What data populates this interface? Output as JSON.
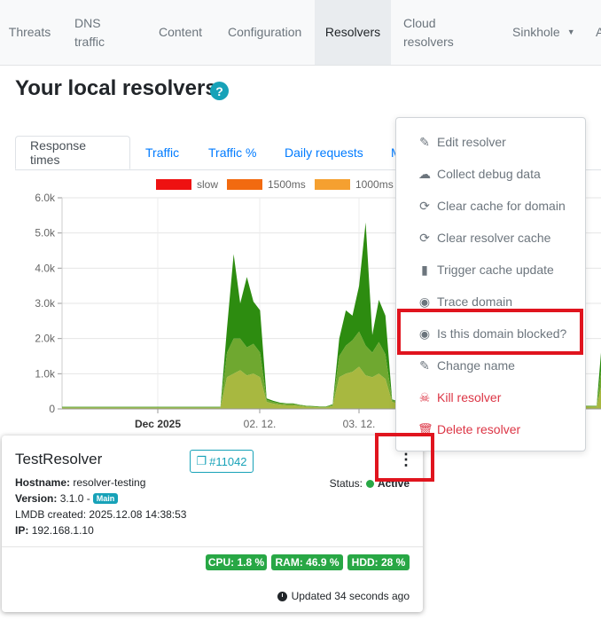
{
  "nav": {
    "items": [
      {
        "label": "Threats",
        "active": false
      },
      {
        "label": "DNS traffic",
        "active": false
      },
      {
        "label": "Content",
        "active": false
      },
      {
        "label": "Configuration",
        "active": false
      },
      {
        "label": "Resolvers",
        "active": true
      },
      {
        "label": "Cloud resolvers",
        "active": false
      },
      {
        "label": "Sinkhole",
        "active": false
      },
      {
        "label": "A",
        "active": false
      }
    ]
  },
  "page": {
    "title": "Your local resolvers",
    "help_icon": "question-circle-icon"
  },
  "tabs": [
    {
      "label": "Response times",
      "active": true
    },
    {
      "label": "Traffic",
      "active": false
    },
    {
      "label": "Traffic %",
      "active": false
    },
    {
      "label": "Daily requests",
      "active": false
    },
    {
      "label": "M",
      "active": false
    }
  ],
  "chart_data": {
    "type": "area",
    "stacked": true,
    "ylim": [
      0,
      6000
    ],
    "yticks": [
      "0",
      "1.0k",
      "2.0k",
      "3.0k",
      "4.0k",
      "5.0k",
      "6.0k"
    ],
    "xticks": [
      "Dec 2025",
      "02. 12.",
      "03. 12."
    ],
    "legend": [
      {
        "name": "slow",
        "color": "#ee1111"
      },
      {
        "name": "1500ms",
        "color": "#f26a10"
      },
      {
        "name": "1000ms",
        "color": "#f5a030"
      }
    ],
    "x": [
      0,
      1,
      2,
      3,
      4,
      5,
      6,
      7,
      8,
      9,
      10,
      11,
      12,
      13,
      14,
      15,
      16,
      17,
      18,
      19,
      20,
      21,
      22,
      23,
      24,
      25,
      26,
      27,
      28,
      29,
      30,
      31,
      32,
      33,
      34,
      35,
      36,
      37,
      38,
      39,
      40,
      41,
      42,
      43,
      44,
      45,
      46,
      47,
      48,
      49,
      50,
      51,
      52,
      53,
      54,
      55,
      56,
      57,
      58,
      59,
      60,
      61,
      62,
      63,
      64,
      65,
      66,
      67,
      68,
      69,
      70,
      71,
      72,
      73,
      74,
      75,
      76,
      77,
      78,
      79,
      80,
      81,
      82,
      83
    ],
    "series": [
      {
        "color": "#a8b840",
        "values": [
          30,
          30,
          30,
          30,
          30,
          30,
          30,
          30,
          30,
          30,
          30,
          30,
          30,
          30,
          30,
          30,
          30,
          30,
          30,
          30,
          30,
          30,
          30,
          30,
          30,
          900,
          1000,
          1100,
          950,
          1000,
          900,
          200,
          150,
          120,
          100,
          100,
          80,
          60,
          50,
          40,
          40,
          80,
          900,
          1000,
          1050,
          1200,
          950,
          900,
          1000,
          850,
          200,
          150,
          120,
          100,
          100,
          80,
          80,
          60,
          60,
          300,
          900,
          150,
          100,
          80,
          60,
          60,
          60,
          60,
          60,
          60,
          60,
          60,
          60,
          60,
          60,
          60,
          60,
          60,
          60,
          60,
          60,
          60,
          900,
          1000
        ]
      },
      {
        "color": "#6fa830",
        "values": [
          20,
          20,
          20,
          20,
          20,
          20,
          20,
          20,
          20,
          20,
          20,
          20,
          20,
          20,
          20,
          20,
          20,
          20,
          20,
          20,
          20,
          20,
          20,
          20,
          20,
          700,
          1000,
          900,
          800,
          850,
          700,
          60,
          50,
          40,
          40,
          40,
          30,
          20,
          20,
          20,
          20,
          30,
          600,
          800,
          900,
          1000,
          850,
          700,
          900,
          700,
          50,
          40,
          40,
          30,
          30,
          30,
          20,
          20,
          20,
          100,
          600,
          40,
          30,
          20,
          20,
          20,
          20,
          20,
          20,
          20,
          20,
          20,
          20,
          20,
          20,
          20,
          20,
          20,
          20,
          20,
          20,
          20,
          700,
          800
        ]
      },
      {
        "color": "#2d8c10",
        "values": [
          10,
          10,
          10,
          10,
          10,
          10,
          10,
          10,
          10,
          10,
          10,
          10,
          10,
          10,
          10,
          10,
          10,
          10,
          10,
          10,
          10,
          10,
          10,
          10,
          10,
          700,
          2400,
          1000,
          2000,
          1200,
          1200,
          40,
          30,
          20,
          20,
          20,
          10,
          10,
          10,
          10,
          10,
          20,
          500,
          1000,
          700,
          1300,
          3500,
          500,
          1200,
          1100,
          20,
          20,
          20,
          10,
          10,
          10,
          10,
          10,
          10,
          50,
          500,
          20,
          10,
          10,
          10,
          10,
          10,
          10,
          10,
          10,
          10,
          10,
          10,
          10,
          10,
          10,
          10,
          10,
          10,
          10,
          10,
          10,
          800,
          1000
        ]
      }
    ]
  },
  "card": {
    "title": "TestResolver",
    "ticket": "#11042",
    "hostname_label": "Hostname:",
    "hostname": "resolver-testing",
    "version_label": "Version:",
    "version": "3.1.0 -",
    "version_badge": "Main",
    "lmdb": "LMDB created: 2025.12.08 14:38:53",
    "ip_label": "IP:",
    "ip": "192.168.1.10",
    "status_label": "Status:",
    "status": "Active",
    "cpu": "CPU: 1.8 %",
    "ram": "RAM: 46.9 %",
    "hdd": "HDD: 28 %",
    "updated": "Updated 34 seconds ago"
  },
  "menu": {
    "items": [
      {
        "label": "Edit resolver",
        "icon": "edit-icon",
        "glyph": "✎"
      },
      {
        "label": "Collect debug data",
        "icon": "cloud-upload-icon",
        "glyph": "☁"
      },
      {
        "label": "Clear cache for domain",
        "icon": "sync-icon",
        "glyph": "⟳"
      },
      {
        "label": "Clear resolver cache",
        "icon": "sync-icon",
        "glyph": "⟳"
      },
      {
        "label": "Trigger cache update",
        "icon": "file-icon",
        "glyph": "▮"
      },
      {
        "label": "Trace domain",
        "icon": "dot-circle-icon",
        "glyph": "◉"
      },
      {
        "label": "Is this domain blocked?",
        "icon": "dot-circle-icon",
        "glyph": "◉"
      },
      {
        "label": "Change name",
        "icon": "pencil-icon",
        "glyph": "✎"
      },
      {
        "label": "Kill resolver",
        "icon": "skull-crossbones-icon",
        "glyph": "☠"
      },
      {
        "label": "Delete resolver",
        "icon": "trash-icon",
        "glyph": "🗑"
      }
    ]
  },
  "colors": {
    "accent": "#007bff",
    "info": "#17a2b8",
    "success": "#28a745",
    "danger": "#dc3545",
    "highlight": "#e0141e"
  }
}
